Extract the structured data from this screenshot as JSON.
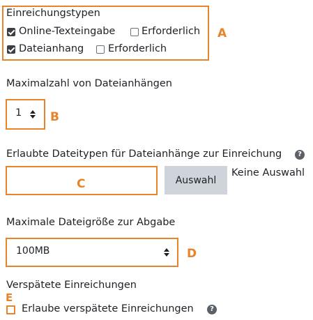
{
  "submission_types": {
    "heading": "Einreichungstypen",
    "online_text": {
      "label": "Online-Texteingabe",
      "checked": true,
      "required_label": "Erforderlich",
      "required_checked": false
    },
    "file": {
      "label": "Dateianhang",
      "checked": true,
      "required_label": "Erforderlich",
      "required_checked": false
    }
  },
  "max_files": {
    "label": "Maximalzahl von Dateianhängen",
    "value": "1"
  },
  "file_types": {
    "label": "Erlaubte Dateitypen für Dateianhänge zur Einreichung",
    "select_button": "Auswahl",
    "none_text": "Keine Auswahl"
  },
  "max_size": {
    "label": "Maximale Dateigröße zur Abgabe",
    "value": "100MB"
  },
  "late": {
    "heading": "Verspätete Einreichungen",
    "checkbox_label": "Erlaube verspätete Einreichungen",
    "checked": false
  },
  "markers": {
    "a": "A",
    "b": "B",
    "c": "C",
    "d": "D",
    "e": "E"
  },
  "help_icon_glyph": "?",
  "colors": {
    "annotation": "#e8832a",
    "button_bg": "#ced4da",
    "text": "#1d2125"
  }
}
